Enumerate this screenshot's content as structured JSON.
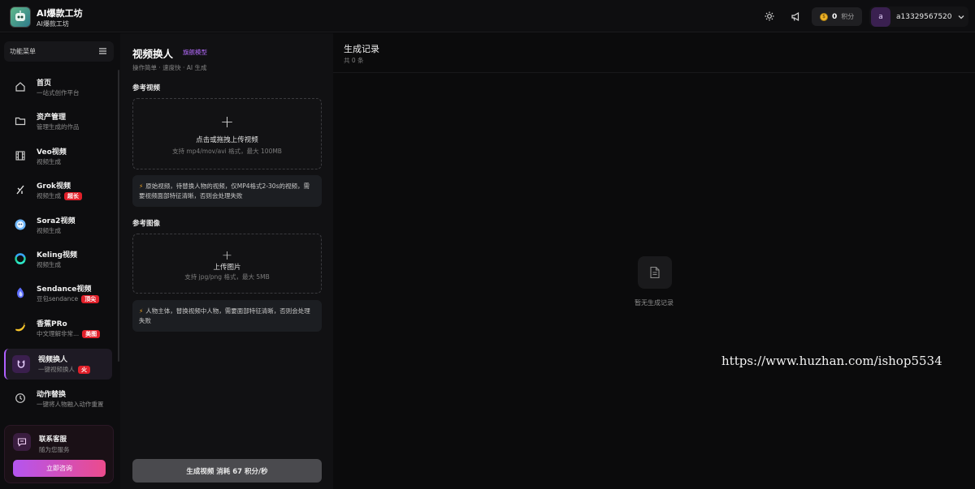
{
  "app": {
    "title": "AI爆款工坊",
    "subtitle": "AI爆款工坊",
    "logo_icon": "robot-avatar-icon"
  },
  "topbar": {
    "theme_icon": "sun-icon",
    "announce_icon": "megaphone-icon",
    "points_value": "0",
    "points_unit": "积分",
    "avatar_letter": "a",
    "username": "a13329567520"
  },
  "sidebar": {
    "menu_title": "功能菜单",
    "items": [
      {
        "label": "首页",
        "sub": "一站式创作平台",
        "icon": "home-icon",
        "tag": "",
        "active": false
      },
      {
        "label": "资产管理",
        "sub": "管理生成的作品",
        "icon": "folder-icon",
        "tag": "",
        "active": false
      },
      {
        "label": "Veo视频",
        "sub": "视频生成",
        "icon": "film-icon",
        "tag": "",
        "active": false
      },
      {
        "label": "Grok视频",
        "sub": "视频生成",
        "icon": "grok-icon",
        "tag": "超长",
        "active": false
      },
      {
        "label": "Sora2视频",
        "sub": "视频生成",
        "icon": "sora-icon",
        "tag": "",
        "active": false
      },
      {
        "label": "Keling视频",
        "sub": "视频生成",
        "icon": "kling-icon",
        "tag": "",
        "active": false
      },
      {
        "label": "Sendance视频",
        "sub": "豆包sendance",
        "icon": "seedance-icon",
        "tag": "顶尖",
        "active": false
      },
      {
        "label": "香蕉PRo",
        "sub": "中文理解非常...",
        "icon": "banana-icon",
        "tag": "美图",
        "active": false
      },
      {
        "label": "视频换人",
        "sub": "一键视频换人",
        "icon": "magnet-icon",
        "tag": "火",
        "active": true
      },
      {
        "label": "动作替换",
        "sub": "一键将人物融入动作重置",
        "icon": "clock-icon",
        "tag": "",
        "active": false
      }
    ],
    "support": {
      "title": "联系客服",
      "sub": "随为您服务",
      "button": "立即咨询"
    }
  },
  "panel": {
    "title": "视频换人",
    "badge": "旗舰模型",
    "subtitle": "操作简单 · 速度快 · AI 生成",
    "video_section": "参考视频",
    "video_upload": "点击或拖拽上传视频",
    "video_hint": "支持 mp4/mov/avi 格式，最大 100MB",
    "video_note": "原始视频，待替换人物的视频，仅MP4格式2-30s的视频，需要视频面部特征清晰，否则会处理失败",
    "image_section": "参考图像",
    "image_upload": "上传图片",
    "image_hint": "支持 jpg/png 格式，最大 5MB",
    "image_note": "人物主体，替换视频中人物，需要面部特征清晰，否则会处理失败",
    "generate_button": "生成视频 消耗 67 积分/秒"
  },
  "records": {
    "title": "生成记录",
    "count": "共 0 条",
    "empty_text": "暂无生成记录",
    "empty_icon": "document-icon"
  },
  "watermark": "https://www.huzhan.com/ishop5534",
  "colors": {
    "accent": "#b060ff",
    "tag_red": "#e1202a",
    "coin": "#f0b428"
  }
}
